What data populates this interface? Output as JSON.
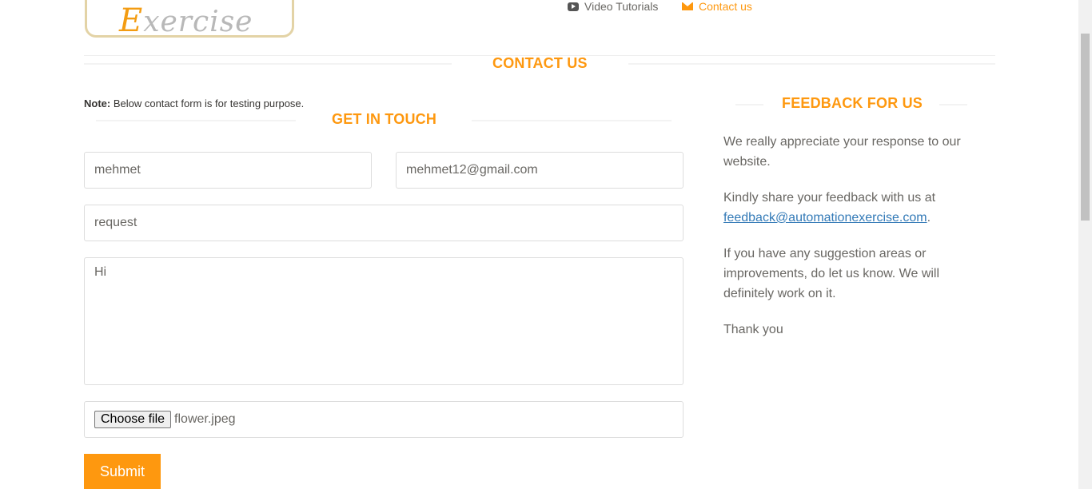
{
  "logo": {
    "text_first": "E",
    "text_rest": "xercise"
  },
  "nav": {
    "video_tutorials": "Video Tutorials",
    "contact_us": "Contact us"
  },
  "page": {
    "title": "CONTACT US",
    "note_label": "Note:",
    "note_text": " Below contact form is for testing purpose."
  },
  "form": {
    "heading": "GET IN TOUCH",
    "name_value": "mehmet",
    "email_value": "mehmet12@gmail.com",
    "subject_value": "request",
    "message_value": "Hi",
    "file_button": "Choose file",
    "file_name": "flower.jpeg",
    "submit_label": "Submit"
  },
  "feedback": {
    "heading": "FEEDBACK FOR US",
    "p1": "We really appreciate your response to our website.",
    "p2_prefix": "Kindly share your feedback with us at ",
    "p2_email": "feedback@automationexercise.com",
    "p2_suffix": ".",
    "p3": "If you have any suggestion areas or improvements, do let us know. We will definitely work on it.",
    "p4": "Thank you"
  },
  "colors": {
    "accent": "#fe980f",
    "link": "#337ab7",
    "text": "#696763"
  },
  "icons": {
    "video": "youtube-play-icon",
    "contact": "envelope-icon"
  }
}
